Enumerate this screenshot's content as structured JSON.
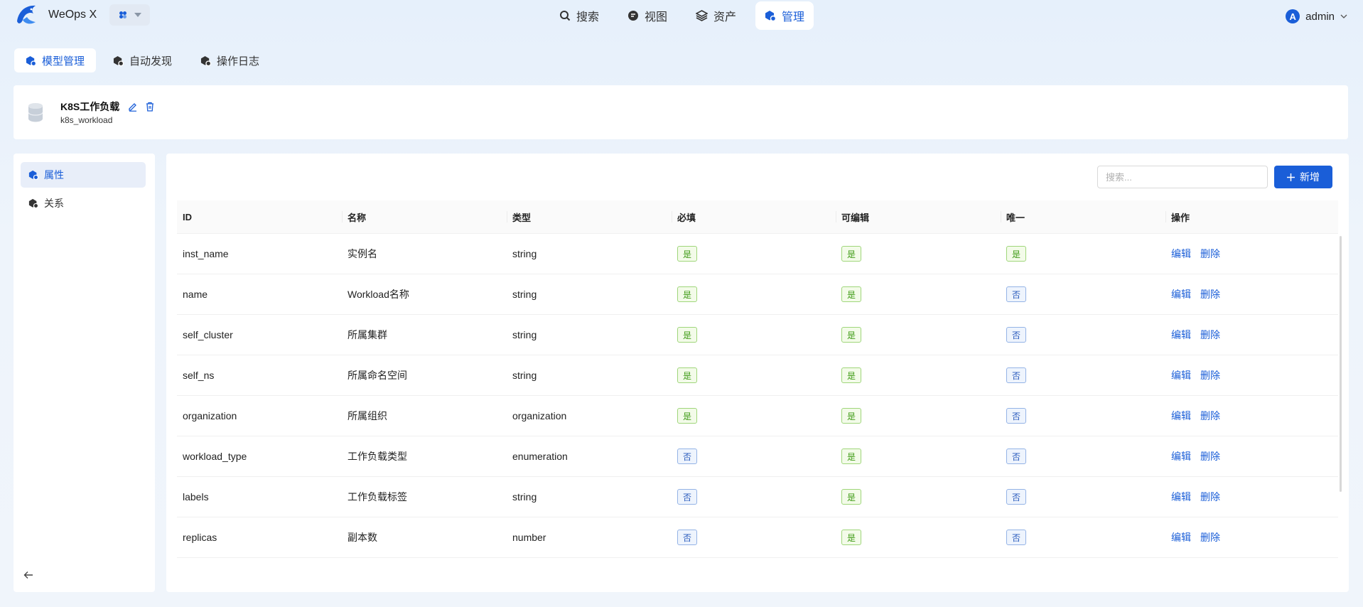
{
  "header": {
    "app_name": "WeOps X",
    "nav": [
      {
        "label": "搜索",
        "icon": "search-icon"
      },
      {
        "label": "视图",
        "icon": "view-icon"
      },
      {
        "label": "资产",
        "icon": "layers-icon"
      },
      {
        "label": "管理",
        "icon": "settings-cube-icon"
      }
    ],
    "active_nav": "管理",
    "user": {
      "avatar_letter": "A",
      "name": "admin"
    }
  },
  "subtabs": [
    {
      "label": "模型管理",
      "active": true
    },
    {
      "label": "自动发现",
      "active": false
    },
    {
      "label": "操作日志",
      "active": false
    }
  ],
  "model": {
    "name": "K8S工作负载",
    "id": "k8s_workload"
  },
  "sidebar": {
    "items": [
      {
        "label": "属性",
        "active": true
      },
      {
        "label": "关系",
        "active": false
      }
    ]
  },
  "toolbar": {
    "search_placeholder": "搜索...",
    "add_label": "新增"
  },
  "table": {
    "headers": [
      "ID",
      "名称",
      "类型",
      "必填",
      "可编辑",
      "唯一",
      "操作"
    ],
    "edit_label": "编辑",
    "delete_label": "删除",
    "yes_label": "是",
    "no_label": "否",
    "rows": [
      {
        "id": "inst_name",
        "name": "实例名",
        "type": "string",
        "required": true,
        "editable": true,
        "unique": true
      },
      {
        "id": "name",
        "name": "Workload名称",
        "type": "string",
        "required": true,
        "editable": true,
        "unique": false
      },
      {
        "id": "self_cluster",
        "name": "所属集群",
        "type": "string",
        "required": true,
        "editable": true,
        "unique": false
      },
      {
        "id": "self_ns",
        "name": "所属命名空间",
        "type": "string",
        "required": true,
        "editable": true,
        "unique": false
      },
      {
        "id": "organization",
        "name": "所属组织",
        "type": "organization",
        "required": true,
        "editable": true,
        "unique": false
      },
      {
        "id": "workload_type",
        "name": "工作负载类型",
        "type": "enumeration",
        "required": false,
        "editable": true,
        "unique": false
      },
      {
        "id": "labels",
        "name": "工作负载标签",
        "type": "string",
        "required": false,
        "editable": true,
        "unique": false
      },
      {
        "id": "replicas",
        "name": "副本数",
        "type": "number",
        "required": false,
        "editable": true,
        "unique": false
      }
    ]
  },
  "colors": {
    "primary": "#1a5ed8",
    "yes": "#3d9a14",
    "no": "#2a5bbd"
  }
}
